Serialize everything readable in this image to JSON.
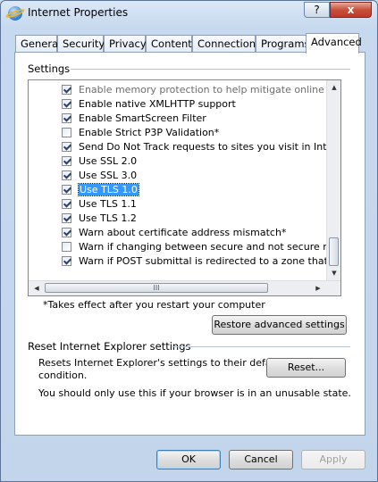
{
  "window": {
    "title": "Internet Properties",
    "help_label": "?",
    "close_label": "x"
  },
  "tabs": [
    {
      "label": "General"
    },
    {
      "label": "Security"
    },
    {
      "label": "Privacy"
    },
    {
      "label": "Content"
    },
    {
      "label": "Connections"
    },
    {
      "label": "Programs"
    },
    {
      "label": "Advanced"
    }
  ],
  "settings": {
    "group_label": "Settings",
    "items": [
      {
        "label": "Enable memory protection to help mitigate online attacks*",
        "checked": true,
        "dim": true
      },
      {
        "label": "Enable native XMLHTTP support",
        "checked": true
      },
      {
        "label": "Enable SmartScreen Filter",
        "checked": true
      },
      {
        "label": "Enable Strict P3P Validation*",
        "checked": false
      },
      {
        "label": "Send Do Not Track requests to sites you visit in Internet E",
        "checked": true
      },
      {
        "label": "Use SSL 2.0",
        "checked": true
      },
      {
        "label": "Use SSL 3.0",
        "checked": true
      },
      {
        "label": "Use TLS 1.0",
        "checked": true,
        "selected": true
      },
      {
        "label": "Use TLS 1.1",
        "checked": true
      },
      {
        "label": "Use TLS 1.2",
        "checked": true
      },
      {
        "label": "Warn about certificate address mismatch*",
        "checked": true
      },
      {
        "label": "Warn if changing between secure and not secure mode",
        "checked": false
      },
      {
        "label": "Warn if POST submittal is redirected to a zone that does n",
        "checked": true
      }
    ],
    "hscroll_grip": "III",
    "note": "*Takes effect after you restart your computer",
    "restore_button": "Restore advanced settings"
  },
  "reset": {
    "group_label": "Reset Internet Explorer settings",
    "description_line1": "Resets Internet Explorer's settings to their default",
    "description_line2": "condition.",
    "reset_button": "Reset...",
    "warning": "You should only use this if your browser is in an unusable state."
  },
  "footer": {
    "ok": "OK",
    "cancel": "Cancel",
    "apply": "Apply"
  }
}
